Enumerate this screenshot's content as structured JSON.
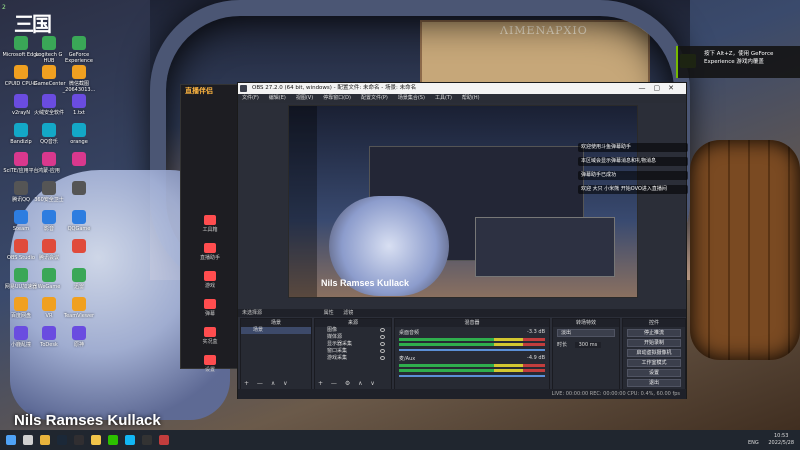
{
  "desktop": {
    "logo_number": "2",
    "logo_text": "三国",
    "icons_col1": [
      "Microsoft Edge",
      "CPUID CPU-Z",
      "v2rayN",
      "Bandizip",
      "SciTE/应用平台",
      "腾讯QQ",
      "Steam",
      "OBS Studio",
      "网易UU加速器",
      "百度网盘",
      "小鹿乱撞"
    ],
    "icons_col2": [
      "Logitech G HUB",
      "iGameCenter",
      "火绒安全软件",
      "QQ音乐",
      "鸿蒙-应用",
      "360安全卫士",
      "影音",
      "腾讯会议",
      "WeGame",
      "VR",
      "ToDesk"
    ],
    "icons_col3": [
      "GeForce Experience",
      "微信截图_20643013...",
      "1.txt",
      "orange",
      "",
      "",
      "QQGame",
      "",
      "迅雷",
      "TeamViewer",
      "原神"
    ],
    "wallpaper_sign": "ΛΙΜΕΝΑΡΧΙΟ",
    "caption": "Nils Ramses Kullack"
  },
  "geforce_toast": {
    "line1": "按下 Alt+Z，使用 GeForce",
    "line2": "Experience 游戏内覆盖"
  },
  "live_assistant": {
    "title": "直播伴侣",
    "items": [
      "工具箱",
      "直播助手",
      "游戏",
      "弹幕",
      "实况盒",
      "设置"
    ]
  },
  "obs": {
    "title": "OBS 27.2.0 (64 bit, windows) - 配置文件: 未命名 - 场景: 未命名",
    "menu": [
      "文件(F)",
      "编辑(E)",
      "视图(V)",
      "停靠窗口(D)",
      "配置文件(P)",
      "场景集合(S)",
      "工具(T)",
      "帮助(H)"
    ],
    "preview_caption": "Nils Ramses Kullack",
    "chat_messages": [
      "欢迎使用斗鱼弹幕助手",
      "本区域会显示弹幕消息和礼物消息",
      "弹幕助手已成功",
      "欢迎 大只 小米熊 开始OVO进入直播间"
    ],
    "dock_tabs": [
      "未选择源",
      "属性",
      "滤镜"
    ],
    "scenes_title": "场景",
    "scenes": [
      "场景"
    ],
    "sources_title": "来源",
    "sources": [
      "图像",
      "媒体源",
      "显示器采集",
      "窗口采集",
      "游戏采集"
    ],
    "mixer_title": "混音器",
    "mixer": [
      {
        "name": "桌面音频",
        "db": "-3.3 dB"
      },
      {
        "name": "麦/Aux",
        "db": "-4.9 dB"
      }
    ],
    "transitions_title": "转场特效",
    "transition": "淡出",
    "duration_label": "时长",
    "duration": "300 ms",
    "controls_title": "控件",
    "controls": [
      "停止推流",
      "开始录制",
      "启动虚拟摄像机",
      "工作室模式",
      "设置",
      "退出"
    ],
    "status": "LIVE: 00:00:00   REC: 00:00:00   CPU: 0.4%, 60.00 fps"
  },
  "taskbar": {
    "icons": [
      "windows-icon",
      "search-icon",
      "chrome-icon",
      "steam-icon",
      "obs-icon",
      "folder-icon",
      "wechat-icon",
      "qq-icon",
      "terminal-icon",
      "game-icon"
    ],
    "tray_lang": "ENG",
    "time": "10:53",
    "date": "2022/5/28"
  }
}
